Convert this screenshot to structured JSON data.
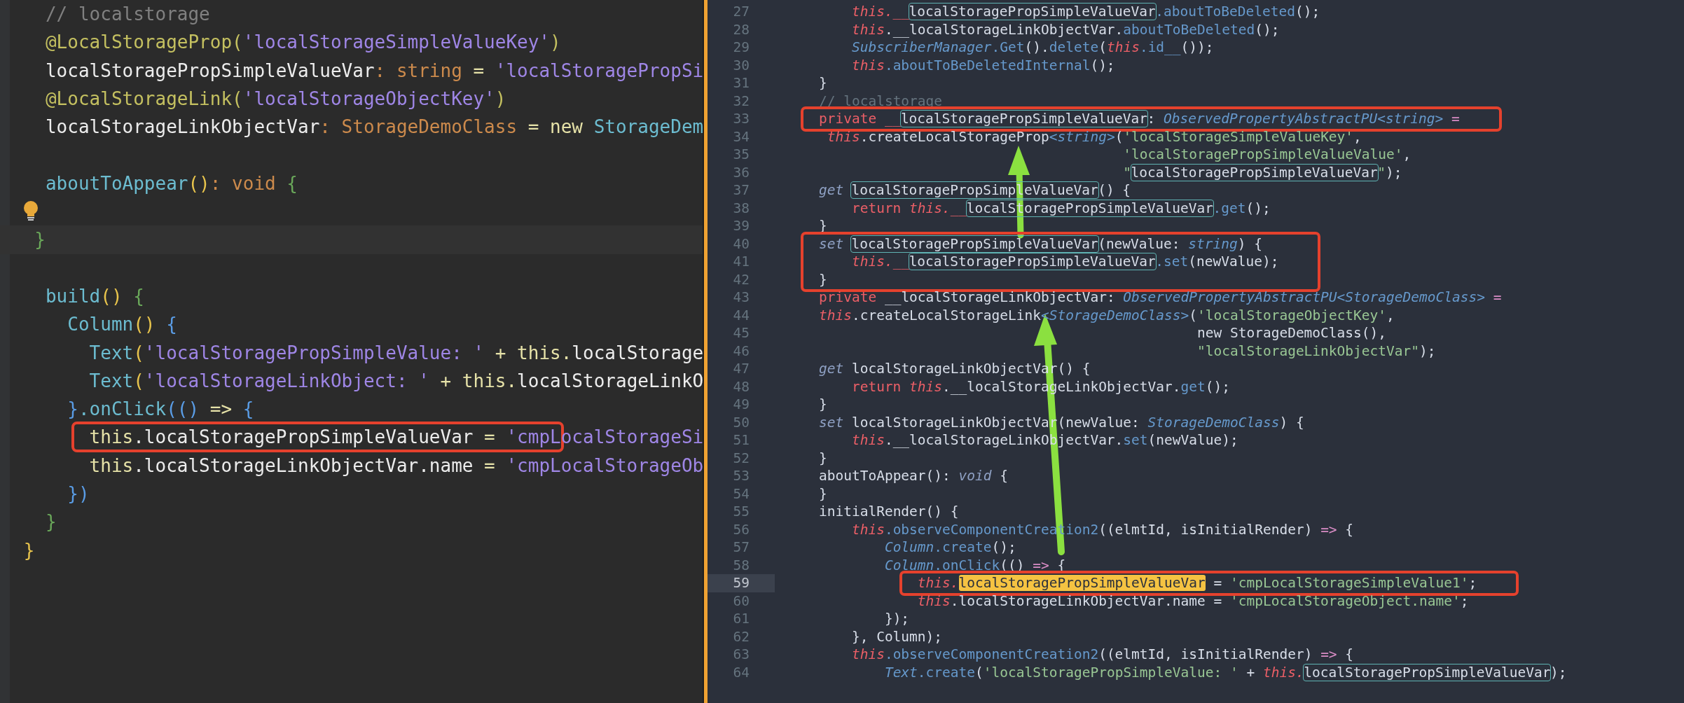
{
  "source_pane": {
    "lines": [
      {
        "kind": "code",
        "tokens": [
          {
            "text": "  // localstorage",
            "kind": "comment"
          }
        ]
      },
      {
        "kind": "code",
        "tokens": [
          {
            "text": "  @LocalStorageProp(",
            "kind": "decorator"
          },
          {
            "text": "'localStorageSimpleValueKey'",
            "kind": "string"
          },
          {
            "text": ")",
            "kind": "decorator"
          }
        ]
      },
      {
        "kind": "code",
        "tokens": [
          {
            "text": "  localStoragePropSimpleValueVar",
            "kind": "identifier"
          },
          {
            "text": ": string",
            "kind": "keyword"
          },
          {
            "text": " = ",
            "kind": "operator"
          },
          {
            "text": "'localStoragePropSi",
            "kind": "string"
          }
        ]
      },
      {
        "kind": "code",
        "tokens": [
          {
            "text": "  @LocalStorageLink(",
            "kind": "decorator"
          },
          {
            "text": "'localStorageObjectKey'",
            "kind": "string"
          },
          {
            "text": ")",
            "kind": "decorator"
          }
        ]
      },
      {
        "kind": "code",
        "tokens": [
          {
            "text": "  localStorageLinkObjectVar",
            "kind": "identifier"
          },
          {
            "text": ": StorageDemoClass",
            "kind": "keyword"
          },
          {
            "text": " = new ",
            "kind": "operator"
          },
          {
            "text": "StorageDem",
            "kind": "call"
          }
        ]
      },
      {
        "kind": "code"
      },
      {
        "kind": "code",
        "tokens": [
          {
            "text": "  aboutToAppear",
            "kind": "call"
          },
          {
            "text": "()",
            "kind": "paren"
          },
          {
            "text": ": void ",
            "kind": "keyword"
          },
          {
            "text": "{",
            "kind": "brace-green"
          }
        ]
      },
      {
        "kind": "hint"
      },
      {
        "kind": "current",
        "tokens": [
          {
            "text": "  }",
            "kind": "brace-green"
          }
        ]
      },
      {
        "kind": "code"
      },
      {
        "kind": "code",
        "tokens": [
          {
            "text": "  build",
            "kind": "call"
          },
          {
            "text": "()",
            "kind": "paren"
          },
          {
            "text": " {",
            "kind": "brace-green"
          }
        ]
      },
      {
        "kind": "code",
        "tokens": [
          {
            "text": "    Column",
            "kind": "call"
          },
          {
            "text": "()",
            "kind": "paren"
          },
          {
            "text": " {",
            "kind": "brace-blue"
          }
        ]
      },
      {
        "kind": "code",
        "tokens": [
          {
            "text": "      Text",
            "kind": "call"
          },
          {
            "text": "(",
            "kind": "paren"
          },
          {
            "text": "'localStoragePropSimpleValue: '",
            "kind": "string"
          },
          {
            "text": " + this.",
            "kind": "operator"
          },
          {
            "text": "localStorage",
            "kind": "identifier"
          }
        ]
      },
      {
        "kind": "code",
        "tokens": [
          {
            "text": "      Text",
            "kind": "call"
          },
          {
            "text": "(",
            "kind": "paren"
          },
          {
            "text": "'localStorageLinkObject: '",
            "kind": "string"
          },
          {
            "text": " + this.",
            "kind": "operator"
          },
          {
            "text": "localStorageLinkO",
            "kind": "identifier"
          }
        ]
      },
      {
        "kind": "code",
        "tokens": [
          {
            "text": "    }",
            "kind": "brace-blue"
          },
          {
            "text": ".onClick",
            "kind": "call"
          },
          {
            "text": "(() ",
            "kind": "brace-blue"
          },
          {
            "text": "=>",
            "kind": "operator"
          },
          {
            "text": " {",
            "kind": "brace-blue"
          }
        ]
      },
      {
        "kind": "code",
        "marked": [
          {
            "text": "      this",
            "kind": "operator"
          },
          {
            "text": ".localStoragePropSimpleValueVar",
            "kind": "identifier"
          },
          {
            "text": " = ",
            "kind": "operator"
          },
          {
            "text": "'cmpL",
            "kind": "string"
          }
        ],
        "tokens": [
          {
            "text": "ocalStorageSi",
            "kind": "string"
          }
        ]
      },
      {
        "kind": "code",
        "tokens": [
          {
            "text": "      this",
            "kind": "operator"
          },
          {
            "text": ".localStorageLinkObjectVar.name",
            "kind": "identifier"
          },
          {
            "text": " = ",
            "kind": "operator"
          },
          {
            "text": "'cmpLocalStorageOb",
            "kind": "string"
          }
        ]
      },
      {
        "kind": "code",
        "tokens": [
          {
            "text": "    })",
            "kind": "brace-blue"
          }
        ]
      },
      {
        "kind": "code",
        "tokens": [
          {
            "text": "  }",
            "kind": "brace-green"
          }
        ]
      },
      {
        "kind": "code",
        "tokens": [
          {
            "text": "}",
            "kind": "paren"
          }
        ]
      }
    ]
  },
  "output_pane": {
    "lines": [
      {
        "number": "27",
        "kind": "code",
        "marked": false,
        "tokens": [
          {
            "text": "        this.__",
            "kind": "this"
          },
          {
            "text": "localStoragePropSimpleValueVar",
            "kind": "outlined"
          },
          {
            "text": ".aboutToBeDeleted",
            "kind": "function"
          },
          {
            "text": "();",
            "kind": "plain"
          }
        ]
      },
      {
        "number": "28",
        "kind": "code",
        "marked": false,
        "tokens": [
          {
            "text": "        this",
            "kind": "this"
          },
          {
            "text": ".__localStorageLinkObjectVar.",
            "kind": "plain"
          },
          {
            "text": "aboutToBeDeleted",
            "kind": "function"
          },
          {
            "text": "();",
            "kind": "plain"
          }
        ]
      },
      {
        "number": "29",
        "kind": "code",
        "marked": false,
        "tokens": [
          {
            "text": "        SubscriberManager",
            "kind": "type"
          },
          {
            "text": ".Get",
            "kind": "function"
          },
          {
            "text": "().",
            "kind": "plain"
          },
          {
            "text": "delete",
            "kind": "function"
          },
          {
            "text": "(",
            "kind": "plain"
          },
          {
            "text": "this",
            "kind": "this"
          },
          {
            "text": ".id__",
            "kind": "function"
          },
          {
            "text": "());",
            "kind": "plain"
          }
        ]
      },
      {
        "number": "30",
        "kind": "code",
        "marked": false,
        "tokens": [
          {
            "text": "        this",
            "kind": "this"
          },
          {
            "text": ".aboutToBeDeletedInternal",
            "kind": "function"
          },
          {
            "text": "();",
            "kind": "plain"
          }
        ]
      },
      {
        "number": "31",
        "kind": "code",
        "marked": false,
        "tokens": [
          {
            "text": "    }",
            "kind": "plain"
          }
        ]
      },
      {
        "number": "32",
        "kind": "code",
        "marked": false,
        "tokens": [
          {
            "text": "    // localstorage",
            "kind": "comment"
          }
        ]
      },
      {
        "number": "33",
        "kind": "code",
        "marked": true,
        "tokens": [
          {
            "text": "    private __",
            "kind": "keyword"
          },
          {
            "text": "localStoragePropSimpleValueVar",
            "kind": "outlined"
          },
          {
            "text": ": ",
            "kind": "plain"
          },
          {
            "text": "ObservedPropertyAbstractPU<string>",
            "kind": "type"
          },
          {
            "text": " =",
            "kind": "operator"
          }
        ]
      },
      {
        "number": "34",
        "kind": "code",
        "marked": false,
        "tokens": [
          {
            "text": "     this",
            "kind": "this"
          },
          {
            "text": ".createLocalStorageProp",
            "kind": "plain"
          },
          {
            "text": "<string>",
            "kind": "type"
          },
          {
            "text": "(",
            "kind": "plain"
          },
          {
            "text": "'localStorageSimpleValueKey'",
            "kind": "string"
          },
          {
            "text": ",",
            "kind": "plain"
          }
        ]
      },
      {
        "number": "35",
        "kind": "code",
        "marked": false,
        "tokens": [
          {
            "text": "                                         'localStoragePropSimpleValueValue'",
            "kind": "string"
          },
          {
            "text": ",",
            "kind": "plain"
          }
        ]
      },
      {
        "number": "36",
        "kind": "code",
        "marked": false,
        "tokens": [
          {
            "text": "                                         \"",
            "kind": "string"
          },
          {
            "text": "localStoragePropSimpleValueVar",
            "kind": "outlined"
          },
          {
            "text": "\"",
            "kind": "string"
          },
          {
            "text": ");",
            "kind": "plain"
          }
        ]
      },
      {
        "number": "37",
        "kind": "code",
        "marked": false,
        "tokens": [
          {
            "text": "    get ",
            "kind": "modifier"
          },
          {
            "text": "localStoragePropSimpleValueVar",
            "kind": "outlined"
          },
          {
            "text": "() {",
            "kind": "plain"
          }
        ]
      },
      {
        "number": "38",
        "kind": "code",
        "marked": false,
        "tokens": [
          {
            "text": "        return ",
            "kind": "keyword"
          },
          {
            "text": "this.__",
            "kind": "this"
          },
          {
            "text": "localStoragePropSimpleValueVar",
            "kind": "outlined"
          },
          {
            "text": ".get",
            "kind": "function"
          },
          {
            "text": "();",
            "kind": "plain"
          }
        ]
      },
      {
        "number": "39",
        "kind": "code",
        "marked": false,
        "tokens": [
          {
            "text": "    }",
            "kind": "plain"
          }
        ]
      },
      {
        "number": "40",
        "kind": "code",
        "marked": true,
        "tokens": [
          {
            "text": "    set ",
            "kind": "modifier"
          },
          {
            "text": "localStoragePropSimpleValueVar",
            "kind": "outlined"
          },
          {
            "text": "(newValue: ",
            "kind": "plain"
          },
          {
            "text": "string",
            "kind": "type"
          },
          {
            "text": ") {",
            "kind": "plain"
          }
        ]
      },
      {
        "number": "41",
        "kind": "code",
        "marked": true,
        "tokens": [
          {
            "text": "        this.__",
            "kind": "this"
          },
          {
            "text": "localStoragePropSimpleValueVar",
            "kind": "outlined"
          },
          {
            "text": ".set",
            "kind": "function"
          },
          {
            "text": "(newValue);",
            "kind": "plain"
          }
        ]
      },
      {
        "number": "42",
        "kind": "code",
        "marked": true,
        "tokens": [
          {
            "text": "    }",
            "kind": "plain"
          }
        ]
      },
      {
        "number": "43",
        "kind": "code",
        "marked": false,
        "tokens": [
          {
            "text": "    private",
            "kind": "keyword"
          },
          {
            "text": " __localStorageLinkObjectVar: ",
            "kind": "plain"
          },
          {
            "text": "ObservedPropertyAbstractPU<StorageDemoClass>",
            "kind": "type"
          },
          {
            "text": " =",
            "kind": "operator"
          }
        ]
      },
      {
        "number": "44",
        "kind": "code",
        "marked": false,
        "tokens": [
          {
            "text": "    this",
            "kind": "this"
          },
          {
            "text": ".createLocalStorageLink",
            "kind": "plain"
          },
          {
            "text": "<StorageDemoClass>",
            "kind": "type"
          },
          {
            "text": "(",
            "kind": "plain"
          },
          {
            "text": "'localStorageObjectKey'",
            "kind": "string"
          },
          {
            "text": ",",
            "kind": "plain"
          }
        ]
      },
      {
        "number": "45",
        "kind": "code",
        "marked": false,
        "tokens": [
          {
            "text": "                                                  new StorageDemoClass(),",
            "kind": "plain"
          }
        ]
      },
      {
        "number": "46",
        "kind": "code",
        "marked": false,
        "tokens": [
          {
            "text": "                                                  \"localStorageLinkObjectVar\"",
            "kind": "string"
          },
          {
            "text": ");",
            "kind": "plain"
          }
        ]
      },
      {
        "number": "47",
        "kind": "code",
        "marked": false,
        "tokens": [
          {
            "text": "    get",
            "kind": "modifier"
          },
          {
            "text": " localStorageLinkObjectVar() {",
            "kind": "plain"
          }
        ]
      },
      {
        "number": "48",
        "kind": "code",
        "marked": false,
        "tokens": [
          {
            "text": "        return ",
            "kind": "keyword"
          },
          {
            "text": "this",
            "kind": "this"
          },
          {
            "text": ".__localStorageLinkObjectVar.",
            "kind": "plain"
          },
          {
            "text": "get",
            "kind": "function"
          },
          {
            "text": "();",
            "kind": "plain"
          }
        ]
      },
      {
        "number": "49",
        "kind": "code",
        "marked": false,
        "tokens": [
          {
            "text": "    }",
            "kind": "plain"
          }
        ]
      },
      {
        "number": "50",
        "kind": "code",
        "marked": false,
        "tokens": [
          {
            "text": "    set",
            "kind": "modifier"
          },
          {
            "text": " localStorageLinkObjectVar(newValue: ",
            "kind": "plain"
          },
          {
            "text": "StorageDemoClass",
            "kind": "type"
          },
          {
            "text": ") {",
            "kind": "plain"
          }
        ]
      },
      {
        "number": "51",
        "kind": "code",
        "marked": false,
        "tokens": [
          {
            "text": "        this",
            "kind": "this"
          },
          {
            "text": ".__localStorageLinkObjectVar.",
            "kind": "plain"
          },
          {
            "text": "set",
            "kind": "function"
          },
          {
            "text": "(newValue);",
            "kind": "plain"
          }
        ]
      },
      {
        "number": "52",
        "kind": "code",
        "marked": false,
        "tokens": [
          {
            "text": "    }",
            "kind": "plain"
          }
        ]
      },
      {
        "number": "53",
        "kind": "code",
        "marked": false,
        "tokens": [
          {
            "text": "    aboutToAppear(): ",
            "kind": "plain"
          },
          {
            "text": "void",
            "kind": "modifier"
          },
          {
            "text": " {",
            "kind": "plain"
          }
        ]
      },
      {
        "number": "54",
        "kind": "code",
        "marked": false,
        "tokens": [
          {
            "text": "    }",
            "kind": "plain"
          }
        ]
      },
      {
        "number": "55",
        "kind": "code",
        "marked": false,
        "tokens": [
          {
            "text": "    initialRender() {",
            "kind": "plain"
          }
        ]
      },
      {
        "number": "56",
        "kind": "code",
        "marked": false,
        "tokens": [
          {
            "text": "        this",
            "kind": "this"
          },
          {
            "text": ".observeComponentCreation2",
            "kind": "function"
          },
          {
            "text": "((elmtId, isInitialRender) ",
            "kind": "plain"
          },
          {
            "text": "=>",
            "kind": "operator"
          },
          {
            "text": " {",
            "kind": "plain"
          }
        ]
      },
      {
        "number": "57",
        "kind": "code",
        "marked": false,
        "tokens": [
          {
            "text": "            Column",
            "kind": "type"
          },
          {
            "text": ".create",
            "kind": "function"
          },
          {
            "text": "();",
            "kind": "plain"
          }
        ]
      },
      {
        "number": "58",
        "kind": "code",
        "marked": false,
        "tokens": [
          {
            "text": "            Column",
            "kind": "type"
          },
          {
            "text": ".onClick",
            "kind": "function"
          },
          {
            "text": "(() ",
            "kind": "plain"
          },
          {
            "text": "=>",
            "kind": "operator"
          },
          {
            "text": " {",
            "kind": "plain"
          }
        ]
      },
      {
        "number": "59",
        "kind": "current",
        "marked": true,
        "tokens": [
          {
            "text": "                this.",
            "kind": "this"
          },
          {
            "text": "localStoragePropSimpleValueVar",
            "kind": "match"
          },
          {
            "text": " = ",
            "kind": "plain"
          },
          {
            "text": "'cmpLocalStorageSimpleValue1'",
            "kind": "string"
          },
          {
            "text": ";",
            "kind": "plain"
          }
        ]
      },
      {
        "number": "60",
        "kind": "code",
        "marked": false,
        "tokens": [
          {
            "text": "                this",
            "kind": "this"
          },
          {
            "text": ".localStorageLinkObjectVar.name = ",
            "kind": "plain"
          },
          {
            "text": "'cmpLocalStorageObject.name'",
            "kind": "string"
          },
          {
            "text": ";",
            "kind": "plain"
          }
        ]
      },
      {
        "number": "61",
        "kind": "code",
        "marked": false,
        "tokens": [
          {
            "text": "            });",
            "kind": "plain"
          }
        ]
      },
      {
        "number": "62",
        "kind": "code",
        "marked": false,
        "tokens": [
          {
            "text": "        }, Column);",
            "kind": "plain"
          }
        ]
      },
      {
        "number": "63",
        "kind": "code",
        "marked": false,
        "tokens": [
          {
            "text": "        this",
            "kind": "this"
          },
          {
            "text": ".observeComponentCreation2",
            "kind": "function"
          },
          {
            "text": "((elmtId, isInitialRender) ",
            "kind": "plain"
          },
          {
            "text": "=>",
            "kind": "operator"
          },
          {
            "text": " {",
            "kind": "plain"
          }
        ]
      },
      {
        "number": "64",
        "kind": "code",
        "marked": false,
        "tokens": [
          {
            "text": "            Text",
            "kind": "type"
          },
          {
            "text": ".create",
            "kind": "function"
          },
          {
            "text": "(",
            "kind": "plain"
          },
          {
            "text": "'localStoragePropSimpleValue: '",
            "kind": "string"
          },
          {
            "text": " + ",
            "kind": "plain"
          },
          {
            "text": "this.",
            "kind": "this"
          },
          {
            "text": "localStoragePropSimpleValueVar",
            "kind": "outlined"
          },
          {
            "text": ");",
            "kind": "plain"
          }
        ]
      }
    ]
  }
}
